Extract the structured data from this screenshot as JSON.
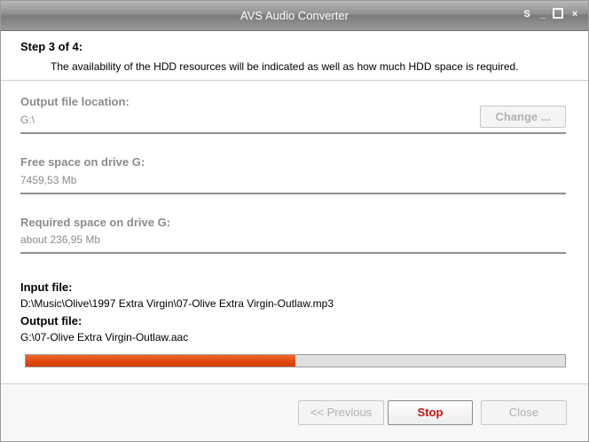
{
  "window": {
    "title": "AVS Audio Converter",
    "controls": {
      "skin": "S",
      "minimize": "_",
      "maximize": "□",
      "close": "×"
    }
  },
  "header": {
    "step": "Step 3 of 4:",
    "description": "The availability of the HDD resources will be indicated as well as how much HDD space is required."
  },
  "output_location": {
    "label": "Output file location:",
    "value": "G:\\",
    "change_label": "Change ..."
  },
  "free_space": {
    "label": "Free space on drive G:",
    "value": "7459,53 Mb"
  },
  "required_space": {
    "label": "Required space on drive G:",
    "value": "about 236,95 Mb"
  },
  "files": {
    "input_label": "Input file:",
    "input_value": "D:\\Music\\Olive\\1997 Extra Virgin\\07-Olive Extra Virgin-Outlaw.mp3",
    "output_label": "Output file:",
    "output_value": "G:\\07-Olive Extra Virgin-Outlaw.aac"
  },
  "progress": {
    "fraction": 0.5,
    "color": "#e04a10"
  },
  "footer": {
    "previous_label": "<< Previous",
    "stop_label": "Stop",
    "close_label": "Close"
  },
  "colors": {
    "accent": "#cc1212",
    "disabled_text": "#b0b0b0",
    "muted_label": "#8b8b8b"
  }
}
